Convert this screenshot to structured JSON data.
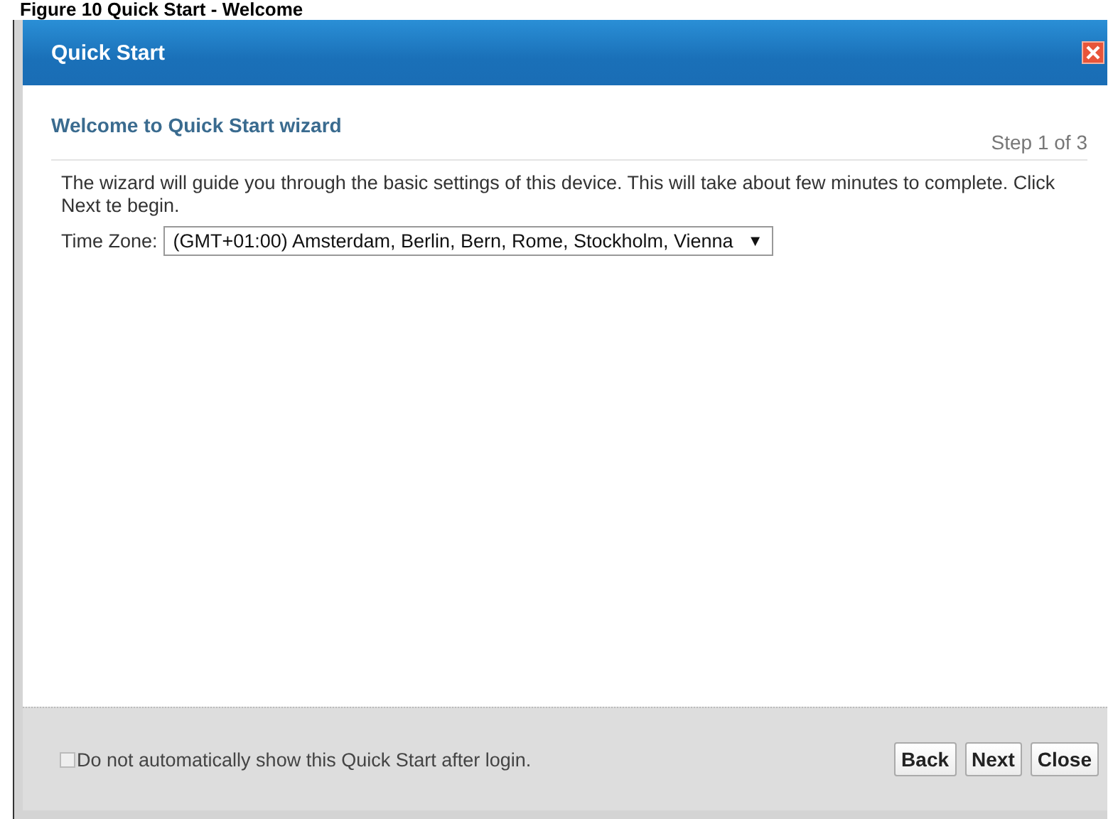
{
  "caption": "Figure 10   Quick Start - Welcome",
  "window": {
    "title": "Quick Start"
  },
  "heading": "Welcome to Quick Start wizard",
  "step": "Step 1 of 3",
  "intro": "The wizard will guide you through the basic settings of this device. This will take about few minutes to complete. Click Next te begin.",
  "time_zone": {
    "label": "Time Zone:",
    "value": "(GMT+01:00) Amsterdam, Berlin, Bern, Rome, Stockholm, Vienna",
    "arrow": "▼"
  },
  "footer": {
    "checkbox": {
      "label": "Do not automatically show this Quick Start after login.",
      "checked": false
    },
    "buttons": [
      "Back",
      "Next",
      "Close"
    ]
  }
}
